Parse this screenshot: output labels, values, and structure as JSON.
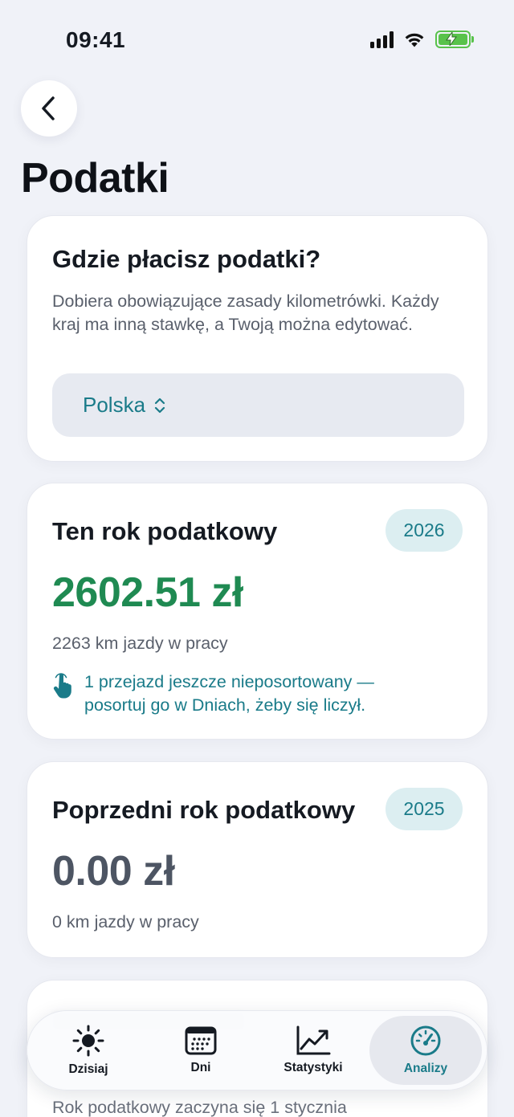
{
  "status_bar": {
    "time": "09:41"
  },
  "header": {
    "title": "Podatki"
  },
  "country_card": {
    "title": "Gdzie płacisz podatki?",
    "description": "Dobiera obowiązujące zasady kilometrówki. Każdy kraj ma inną stawkę, a Twoją można edytować.",
    "selected_country": "Polska"
  },
  "current_year_card": {
    "title": "Ten rok podatkowy",
    "year": "2026",
    "amount": "2602.51 zł",
    "km": "2263 km jazdy w pracy",
    "notice": "1 przejazd jeszcze nieposortowany — posortuj go w Dniach, żeby się liczył."
  },
  "previous_year_card": {
    "title": "Poprzedni rok podatkowy",
    "year": "2025",
    "amount": "0.00 zł",
    "km": "0 km jazdy w pracy"
  },
  "info_card": {
    "text": "Rok podatkowy zaczyna się 1 stycznia"
  },
  "tab_bar": {
    "tabs": [
      {
        "label": "Dzisiaj",
        "icon": "sun-icon"
      },
      {
        "label": "Dni",
        "icon": "calendar-icon"
      },
      {
        "label": "Statystyki",
        "icon": "chart-icon"
      },
      {
        "label": "Analizy",
        "icon": "gauge-icon"
      }
    ],
    "active": "Analizy"
  },
  "colors": {
    "accent": "#1a7b89",
    "positive": "#1f8a52",
    "neutral_amount": "#4d5563",
    "background": "#f0f2f8"
  }
}
